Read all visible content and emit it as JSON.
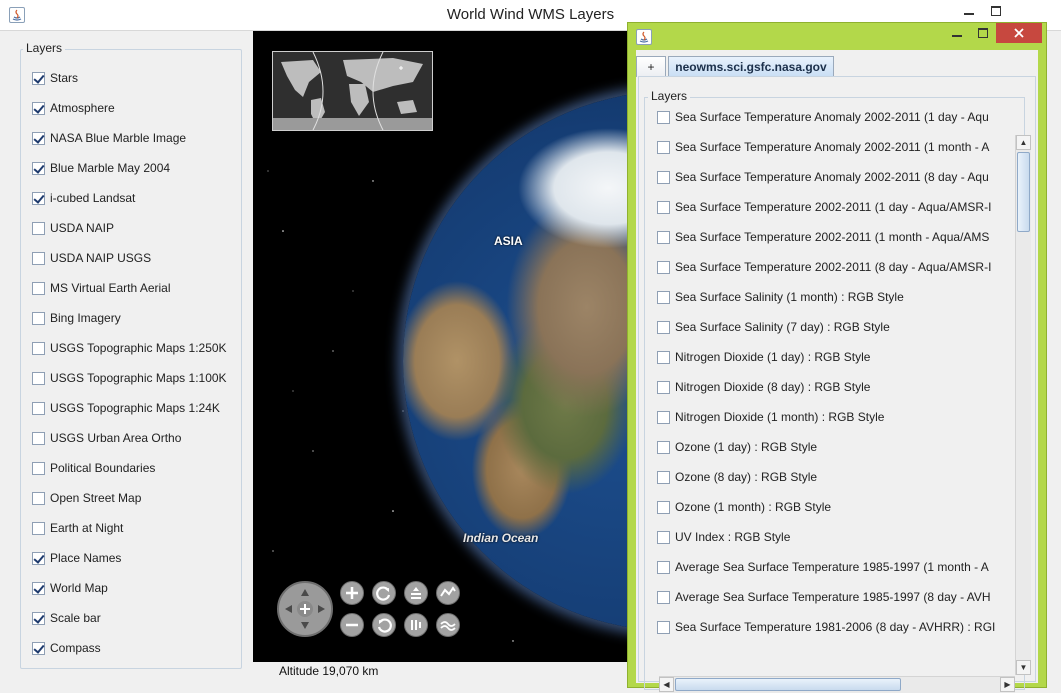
{
  "window": {
    "title": "World Wind WMS Layers"
  },
  "layers_panel": {
    "label": "Layers",
    "items": [
      {
        "label": "Stars",
        "checked": true
      },
      {
        "label": "Atmosphere",
        "checked": true
      },
      {
        "label": "NASA Blue Marble Image",
        "checked": true
      },
      {
        "label": "Blue Marble May 2004",
        "checked": true
      },
      {
        "label": "i-cubed Landsat",
        "checked": true
      },
      {
        "label": "USDA NAIP",
        "checked": false
      },
      {
        "label": "USDA NAIP USGS",
        "checked": false
      },
      {
        "label": "MS Virtual Earth Aerial",
        "checked": false
      },
      {
        "label": "Bing Imagery",
        "checked": false
      },
      {
        "label": "USGS Topographic Maps 1:250K",
        "checked": false
      },
      {
        "label": "USGS Topographic Maps 1:100K",
        "checked": false
      },
      {
        "label": "USGS Topographic Maps 1:24K",
        "checked": false
      },
      {
        "label": "USGS Urban Area Ortho",
        "checked": false
      },
      {
        "label": "Political Boundaries",
        "checked": false
      },
      {
        "label": "Open Street Map",
        "checked": false
      },
      {
        "label": "Earth at Night",
        "checked": false
      },
      {
        "label": "Place Names",
        "checked": true
      },
      {
        "label": "World Map",
        "checked": true
      },
      {
        "label": "Scale bar",
        "checked": true
      },
      {
        "label": "Compass",
        "checked": true
      }
    ]
  },
  "globe": {
    "labels": {
      "asia": "ASIA",
      "ocean": "Indian Ocean"
    },
    "altitude": "Altitude  19,070 km"
  },
  "server_dialog": {
    "tabs": {
      "add": "+",
      "server": "neowms.sci.gsfc.nasa.gov"
    },
    "panel_label": "Layers",
    "items": [
      "Sea Surface Temperature Anomaly 2002-2011 (1 day - Aqu",
      "Sea Surface Temperature Anomaly 2002-2011 (1 month - A",
      "Sea Surface Temperature Anomaly 2002-2011 (8 day - Aqu",
      "Sea Surface Temperature 2002-2011 (1 day - Aqua/AMSR-I",
      "Sea Surface Temperature 2002-2011 (1 month - Aqua/AMS",
      "Sea Surface Temperature 2002-2011 (8 day - Aqua/AMSR-I",
      "Sea Surface Salinity (1 month) : RGB Style",
      "Sea Surface Salinity (7 day) : RGB Style",
      "Nitrogen Dioxide (1 day) : RGB Style",
      "Nitrogen Dioxide (8 day) : RGB Style",
      "Nitrogen Dioxide (1 month) : RGB Style",
      "Ozone (1 day) : RGB Style",
      "Ozone (8 day) : RGB Style",
      "Ozone (1 month) : RGB Style",
      "UV Index : RGB Style",
      "Average Sea Surface Temperature 1985-1997 (1 month - A",
      "Average Sea Surface Temperature 1985-1997 (8 day - AVH",
      "Sea Surface Temperature 1981-2006 (8 day - AVHRR) : RGI"
    ]
  },
  "colors": {
    "dialog_frame": "#b3d84a",
    "close_button": "#c7483f",
    "globe_background": "#000000",
    "checkmark": "#1e3a6e"
  }
}
